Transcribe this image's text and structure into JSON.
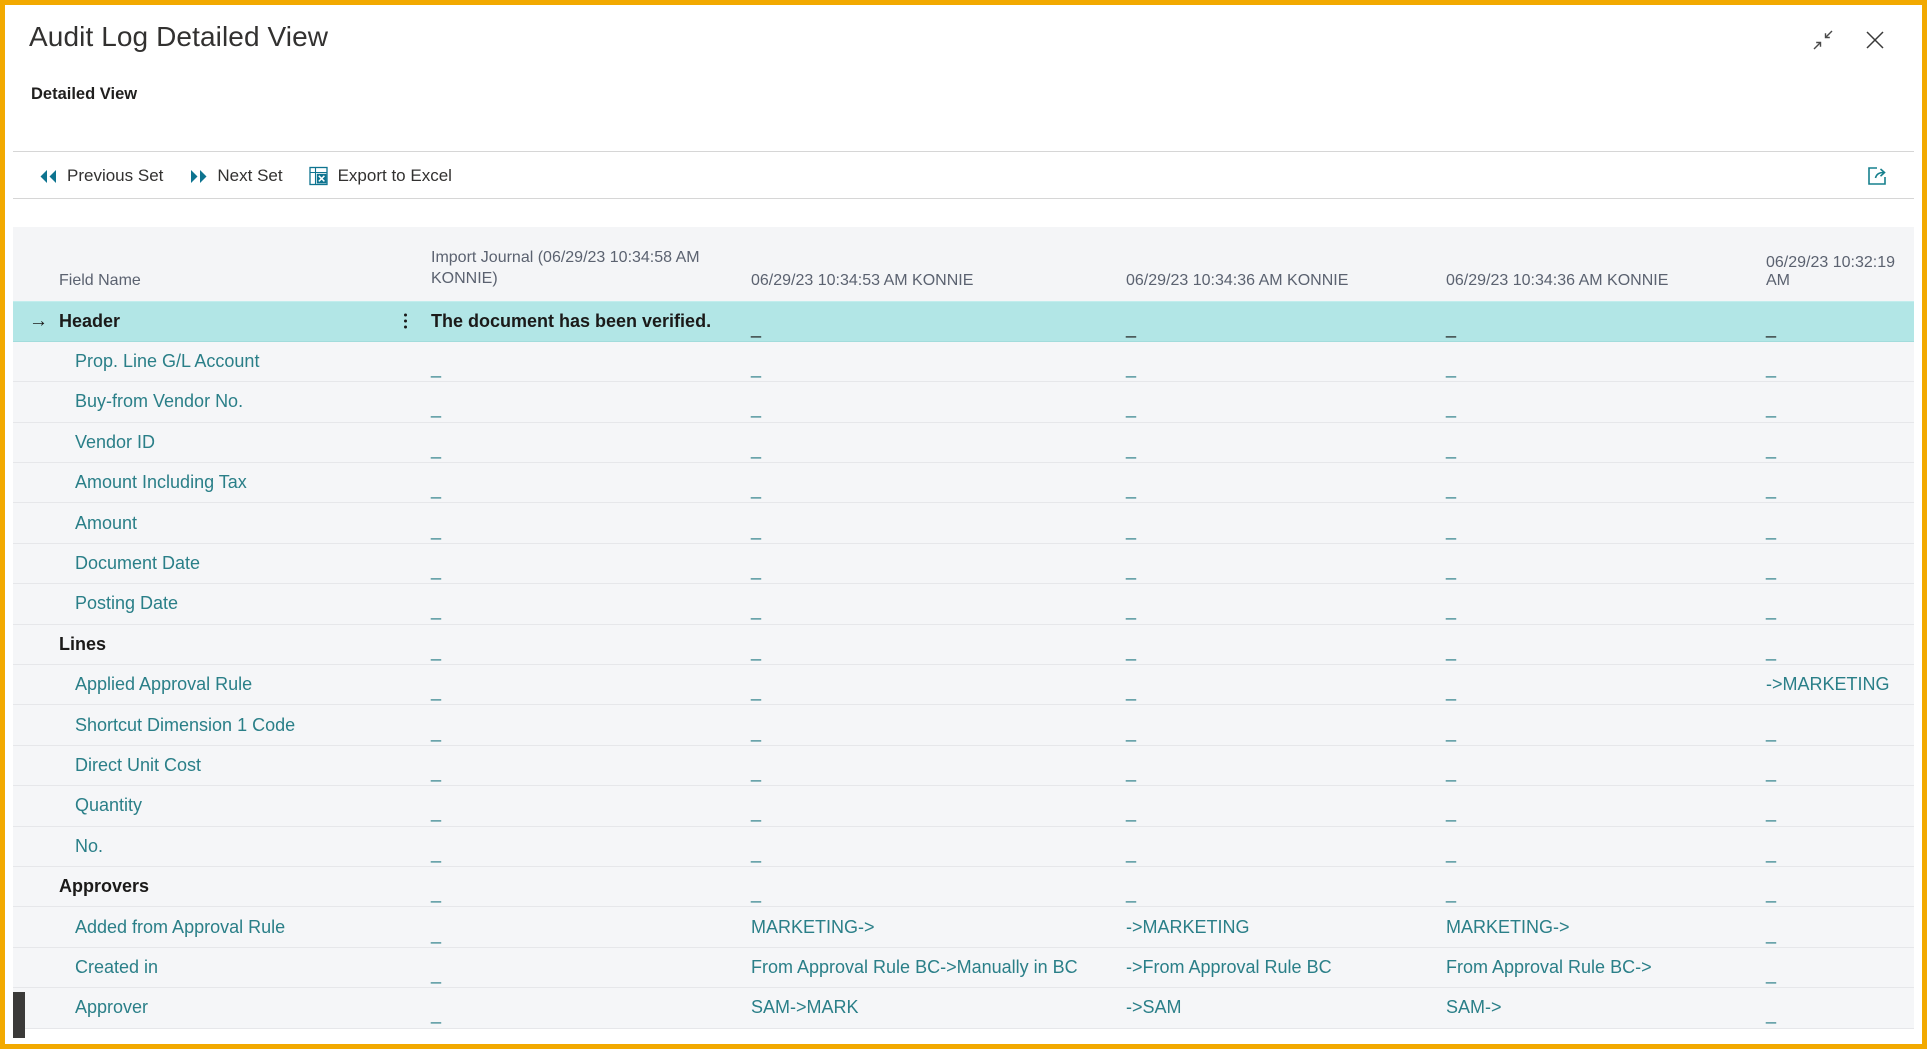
{
  "window": {
    "title": "Audit Log Detailed View",
    "subtitle": "Detailed View",
    "restore_icon": "collapse-arrows-icon",
    "close_icon": "close-icon",
    "accent_border": "#F2A900",
    "selected_row_color": "#b2e6e6",
    "link_color": "#2a7f88"
  },
  "toolbar": {
    "previous_label": "Previous Set",
    "next_label": "Next Set",
    "export_label": "Export to Excel",
    "previous_icon": "double-chevron-left-icon",
    "next_icon": "double-chevron-right-icon",
    "export_icon": "excel-icon",
    "share_icon": "share-open-in-new-icon"
  },
  "table": {
    "columns": [
      "Field Name",
      "Import Journal (06/29/23 10:34:58 AM KONNIE)",
      "06/29/23 10:34:53 AM KONNIE",
      "06/29/23 10:34:36 AM KONNIE",
      "06/29/23 10:34:36 AM KONNIE",
      "06/29/23 10:32:19 AM"
    ],
    "empty_value": "_",
    "rows": [
      {
        "field": "Header",
        "type": "group",
        "selected": true,
        "values": [
          "The document has been verified.",
          "_",
          "_",
          "_",
          "_"
        ]
      },
      {
        "field": "Prop. Line G/L Account",
        "type": "field",
        "selected": false,
        "values": [
          "_",
          "_",
          "_",
          "_",
          "_"
        ]
      },
      {
        "field": "Buy-from Vendor No.",
        "type": "field",
        "selected": false,
        "values": [
          "_",
          "_",
          "_",
          "_",
          "_"
        ]
      },
      {
        "field": "Vendor ID",
        "type": "field",
        "selected": false,
        "values": [
          "_",
          "_",
          "_",
          "_",
          "_"
        ]
      },
      {
        "field": "Amount Including Tax",
        "type": "field",
        "selected": false,
        "values": [
          "_",
          "_",
          "_",
          "_",
          "_"
        ]
      },
      {
        "field": "Amount",
        "type": "field",
        "selected": false,
        "values": [
          "_",
          "_",
          "_",
          "_",
          "_"
        ]
      },
      {
        "field": "Document Date",
        "type": "field",
        "selected": false,
        "values": [
          "_",
          "_",
          "_",
          "_",
          "_"
        ]
      },
      {
        "field": "Posting Date",
        "type": "field",
        "selected": false,
        "values": [
          "_",
          "_",
          "_",
          "_",
          "_"
        ]
      },
      {
        "field": "Lines",
        "type": "group",
        "selected": false,
        "values": [
          "_",
          "_",
          "_",
          "_",
          "_"
        ]
      },
      {
        "field": "Applied Approval Rule",
        "type": "field",
        "selected": false,
        "values": [
          "_",
          "_",
          "_",
          "_",
          "->MARKETING"
        ]
      },
      {
        "field": "Shortcut Dimension 1 Code",
        "type": "field",
        "selected": false,
        "values": [
          "_",
          "_",
          "_",
          "_",
          "_"
        ]
      },
      {
        "field": "Direct Unit Cost",
        "type": "field",
        "selected": false,
        "values": [
          "_",
          "_",
          "_",
          "_",
          "_"
        ]
      },
      {
        "field": "Quantity",
        "type": "field",
        "selected": false,
        "values": [
          "_",
          "_",
          "_",
          "_",
          "_"
        ]
      },
      {
        "field": "No.",
        "type": "field",
        "selected": false,
        "values": [
          "_",
          "_",
          "_",
          "_",
          "_"
        ]
      },
      {
        "field": "Approvers",
        "type": "group",
        "selected": false,
        "values": [
          "_",
          "_",
          "_",
          "_",
          "_"
        ]
      },
      {
        "field": "Added from Approval Rule",
        "type": "field",
        "selected": false,
        "values": [
          "_",
          "MARKETING->",
          "->MARKETING",
          "MARKETING->",
          "_"
        ]
      },
      {
        "field": "Created in",
        "type": "field",
        "selected": false,
        "values": [
          "_",
          "From Approval Rule BC->Manually in BC",
          "->From Approval Rule BC",
          "From Approval Rule BC->",
          "_"
        ]
      },
      {
        "field": "Approver",
        "type": "field",
        "selected": false,
        "values": [
          "_",
          "SAM->MARK",
          "->SAM",
          "SAM->",
          "_"
        ]
      }
    ]
  }
}
